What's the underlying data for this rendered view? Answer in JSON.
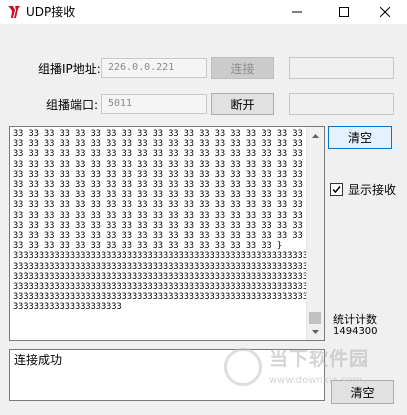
{
  "window": {
    "title": "UDP接收",
    "icon": "app-logo-icon",
    "controls": [
      "minimize-icon",
      "maximize-icon",
      "close-icon"
    ]
  },
  "multicast_ip": {
    "label": "组播IP地址:",
    "value": "226.0.0.221",
    "connect_label": "连接"
  },
  "multicast_port": {
    "label": "组播端口:",
    "value": "5011",
    "disconnect_label": "断开"
  },
  "receive": {
    "text": "33 33 33 33 33 33 33 33 33 33 33 33 33 33 33 33 33 33 33 33\n33 33 33 33 33 33 33 33 33 33 33 33 33 33 33 33 33 33 33 33\n33 33 33 33 33 33 33 33 33 33 33 33 33 33 33 33 33 33 33 33\n33 33 33 33 33 33 33 33 33 33 33 33 33 33 33 33 33 33 33 33\n33 33 33 33 33 33 33 33 33 33 33 33 33 33 33 33 33 33 33 33\n33 33 33 33 33 33 33 33 33 33 33 33 33 33 33 33 33 33 33 33\n33 33 33 33 33 33 33 33 33 33 33 33 33 33 33 33 33 33 33 33\n33 33 33 33 33 33 33 33 33 33 33 33 33 33 33 33 33 33 33 33\n33 33 33 33 33 33 33 33 33 33 33 33 33 33 33 33 33 33 33 33\n33 33 33 33 33 33 33 33 33 33 33 33 33 33 33 33 33 33 33 33\n33 33 33 33 33 33 33 33 33 33 33 33 33 33 33 33 33 33 33 33\n33 33 33 33 33 33 33 33 33 33 33 33 33 33 33 33 33 }\n3333333333333333333333333333333333333333333333333333333333333\n3333333333333333333333333333333333333333333333333333333333333\n3333333333333333333333333333333333333333333333333333333333333\n3333333333333333333333333333333333333333333333333333333333333\n3333333333333333333333333333333333333333333333333333333333333\n333333333333333333333",
    "clear_label": "清空"
  },
  "show_receive": {
    "label": "显示接收",
    "checked": true
  },
  "stats": {
    "label": "统计计数",
    "value": "1494300"
  },
  "status": {
    "text": "连接成功",
    "clear_label": "清空"
  },
  "watermark": {
    "text": "当下软件园",
    "url": "www.downxia.com"
  }
}
